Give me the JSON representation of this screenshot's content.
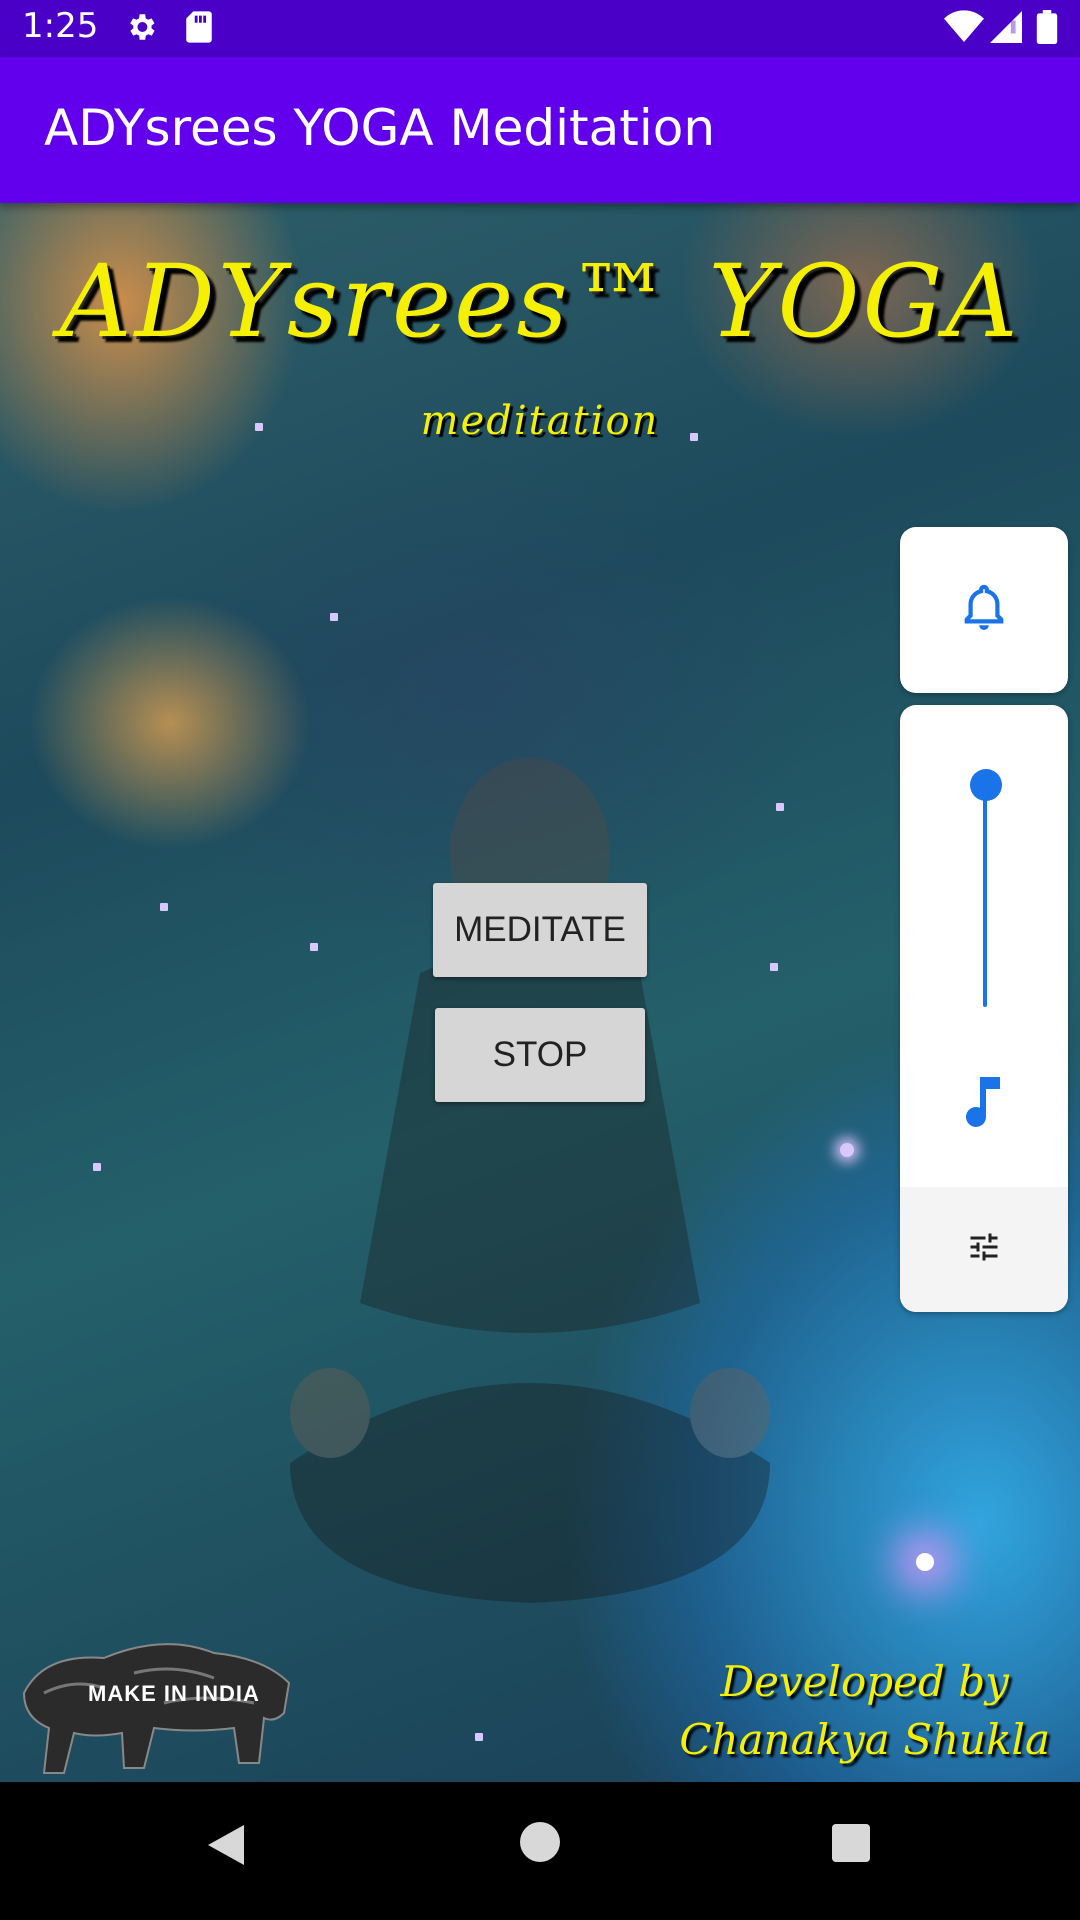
{
  "status_bar": {
    "time": "1:25",
    "icons": [
      "gear-icon",
      "sd-card-icon",
      "wifi-icon",
      "cell-signal-icon",
      "battery-icon"
    ]
  },
  "app_bar": {
    "title": "ADYsrees YOGA Meditation"
  },
  "hero": {
    "title": "ADYsrees™ YOGA",
    "subtitle": "meditation"
  },
  "buttons": {
    "meditate": "MEDITATE",
    "stop": "STOP"
  },
  "credits": {
    "line1": "Developed by",
    "line2": "Chanakya Shukla"
  },
  "logo": {
    "text": "MAKE IN INDIA"
  },
  "volume_panel": {
    "ring_icon": "bell-icon",
    "media_icon": "music-note-icon",
    "settings_icon": "tune-icon",
    "media_level": 1.0,
    "accent": "#1a73e8"
  },
  "nav_bar": {
    "buttons": [
      "back-icon",
      "home-icon",
      "recents-icon"
    ]
  },
  "colors": {
    "status_bar": "#4a00c7",
    "app_bar": "#6200ee",
    "title_text": "#f5f000",
    "button": "#d6d6d6"
  }
}
